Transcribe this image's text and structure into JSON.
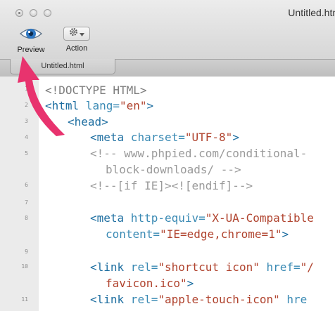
{
  "window": {
    "title": "Untitled.htm"
  },
  "toolbar": {
    "preview_label": "Preview",
    "action_label": "Action"
  },
  "tab": {
    "label": "Untitled.html",
    "close_glyph": "✕"
  },
  "colors": {
    "tag": "#1f6fa1",
    "attribute": "#3a8ab4",
    "string": "#b0432e",
    "comment": "#9a9a9a",
    "arrow": "#e8336e"
  },
  "editor": {
    "line_numbers": [
      "1",
      "2",
      "3",
      "4",
      "5",
      "6",
      "7",
      "8",
      "9",
      "10",
      "11"
    ],
    "lines": [
      {
        "num": "1",
        "tokens": [
          {
            "c": "<!DOCTYPE HTML>",
            "t": "punc"
          }
        ]
      },
      {
        "num": "2",
        "tokens": [
          {
            "c": "<html",
            "t": "tag"
          },
          {
            "c": " lang=",
            "t": "attr"
          },
          {
            "c": "\"en\"",
            "t": "str"
          },
          {
            "c": ">",
            "t": "tag"
          }
        ]
      },
      {
        "num": "3",
        "tokens": [
          {
            "c": "<head>",
            "t": "tag"
          }
        ]
      },
      {
        "num": "4",
        "tokens": [
          {
            "c": "<meta",
            "t": "tag"
          },
          {
            "c": " charset=",
            "t": "attr"
          },
          {
            "c": "\"UTF-8\"",
            "t": "str"
          },
          {
            "c": ">",
            "t": "tag"
          }
        ]
      },
      {
        "num": "5",
        "tokens": [
          {
            "c": "<!-- www.phpied.com/conditional-",
            "t": "comment"
          }
        ]
      },
      {
        "num": "",
        "tokens": [
          {
            "c": "block-downloads/ -->",
            "t": "comment"
          }
        ]
      },
      {
        "num": "6",
        "tokens": [
          {
            "c": "<!--[if IE]><![endif]-->",
            "t": "comment"
          }
        ]
      },
      {
        "num": "7",
        "tokens": []
      },
      {
        "num": "8",
        "tokens": [
          {
            "c": "<meta",
            "t": "tag"
          },
          {
            "c": " http-equiv=",
            "t": "attr"
          },
          {
            "c": "\"X-UA-Compatible",
            "t": "str"
          }
        ]
      },
      {
        "num": "",
        "tokens": [
          {
            "c": "content=",
            "t": "attr"
          },
          {
            "c": "\"IE=edge,chrome=1\"",
            "t": "str"
          },
          {
            "c": ">",
            "t": "tag"
          }
        ]
      },
      {
        "num": "9",
        "tokens": []
      },
      {
        "num": "10",
        "tokens": [
          {
            "c": "<link",
            "t": "tag"
          },
          {
            "c": " rel=",
            "t": "attr"
          },
          {
            "c": "\"shortcut icon\"",
            "t": "str"
          },
          {
            "c": " href=",
            "t": "attr"
          },
          {
            "c": "\"/",
            "t": "str"
          }
        ]
      },
      {
        "num": "",
        "tokens": [
          {
            "c": "favicon.ico\"",
            "t": "str"
          },
          {
            "c": ">",
            "t": "tag"
          }
        ]
      },
      {
        "num": "11",
        "tokens": [
          {
            "c": "<link",
            "t": "tag"
          },
          {
            "c": " rel=",
            "t": "attr"
          },
          {
            "c": "\"apple-touch-icon\"",
            "t": "str"
          },
          {
            "c": " hre",
            "t": "attr"
          }
        ]
      }
    ]
  }
}
